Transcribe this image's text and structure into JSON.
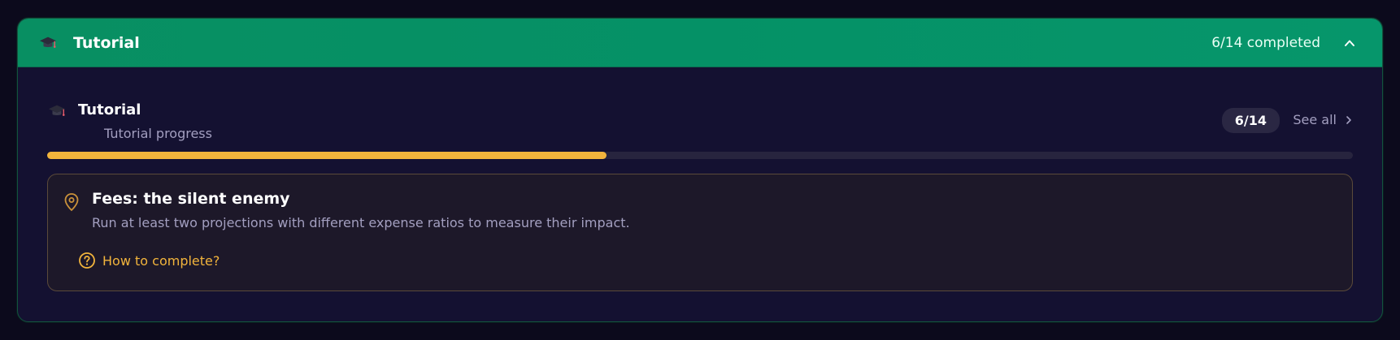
{
  "header": {
    "title": "Tutorial",
    "count": "6/14 completed"
  },
  "section": {
    "title": "Tutorial",
    "caption": "Tutorial progress",
    "count": "6/14",
    "see_all": "See all",
    "progress_fraction": 0.4286
  },
  "task": {
    "title": "Fees: the silent enemy",
    "description": "Run at least two projections with different expense ratios to measure their impact.",
    "help_link": "How to complete?"
  },
  "icons": {
    "header": "graduation-cap-icon",
    "collapse": "chevron-up-icon",
    "section": "graduation-cap-icon",
    "see_all": "chevron-right-icon",
    "task": "map-pin-icon",
    "help": "question-circle-icon"
  },
  "colors": {
    "header_green": "#06966b",
    "accent_yellow": "#f2b43c",
    "panel_bg": "#141131",
    "task_border": "#5b4a3a"
  }
}
